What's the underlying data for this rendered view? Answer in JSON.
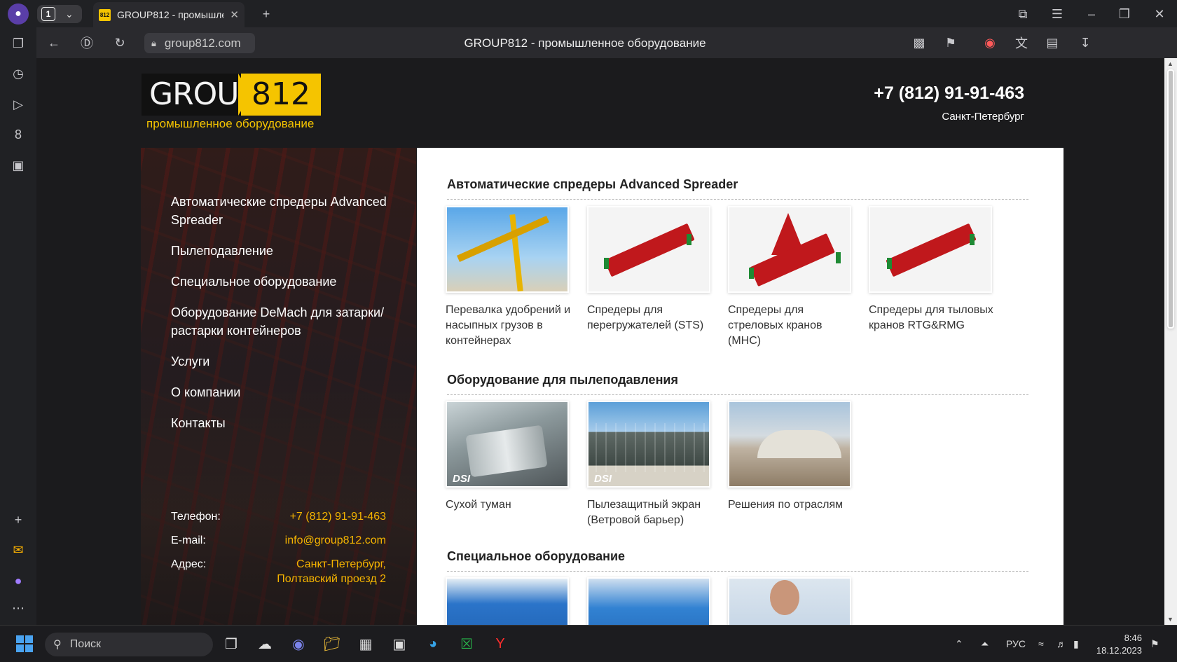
{
  "browser": {
    "tab_count": "1",
    "tab_favicon": "812",
    "tab_title": "GROUP812 - промышле",
    "url": "group812.com",
    "page_title": "GROUP812 - промышленное оборудование"
  },
  "site": {
    "logo_group": "GROUP",
    "logo_num": "812",
    "logo_sub": "промышленное оборудование",
    "phone": "+7 (812) 91-91-463",
    "city": "Санкт-Петербург"
  },
  "nav": [
    {
      "label": "Автоматические спредеры Advanced Spreader"
    },
    {
      "label": "Пылеподавление"
    },
    {
      "label": "Специальное оборудование"
    },
    {
      "label": "Оборудование DeMach для затарки/растарки контейнеров"
    },
    {
      "label": "Услуги"
    },
    {
      "label": "О компании"
    },
    {
      "label": "Контакты"
    }
  ],
  "contacts": {
    "phone_label": "Телефон:",
    "phone": "+7 (812) 91-91-463",
    "email_label": "E-mail:",
    "email": "info@group812.com",
    "address_label": "Адрес:",
    "address": "Санкт-Петербург, Полтавский проезд 2"
  },
  "sections": [
    {
      "title": "Автоматические спредеры Advanced Spreader",
      "cards": [
        {
          "caption": "Перевалка удобрений и насыпных грузов в контейнерах"
        },
        {
          "caption": "Спредеры для перегружателей (STS)"
        },
        {
          "caption": "Спредеры для стреловых кранов (МНС)"
        },
        {
          "caption": "Спредеры для тыловых кранов RTG&RMG"
        }
      ]
    },
    {
      "title": "Оборудование для пылеподавления",
      "cards": [
        {
          "caption": "Сухой туман",
          "badge": "DSI"
        },
        {
          "caption": "Пылезащитный экран (Ветровой барьер)",
          "badge": "DSI"
        },
        {
          "caption": "Решения по отраслям"
        }
      ]
    },
    {
      "title": "Специальное оборудование",
      "cards": [
        {
          "caption": ""
        },
        {
          "caption": ""
        },
        {
          "caption": ""
        }
      ]
    }
  ],
  "taskbar": {
    "search_placeholder": "Поиск",
    "lang": "РУС",
    "time": "8:46",
    "date": "18.12.2023"
  }
}
